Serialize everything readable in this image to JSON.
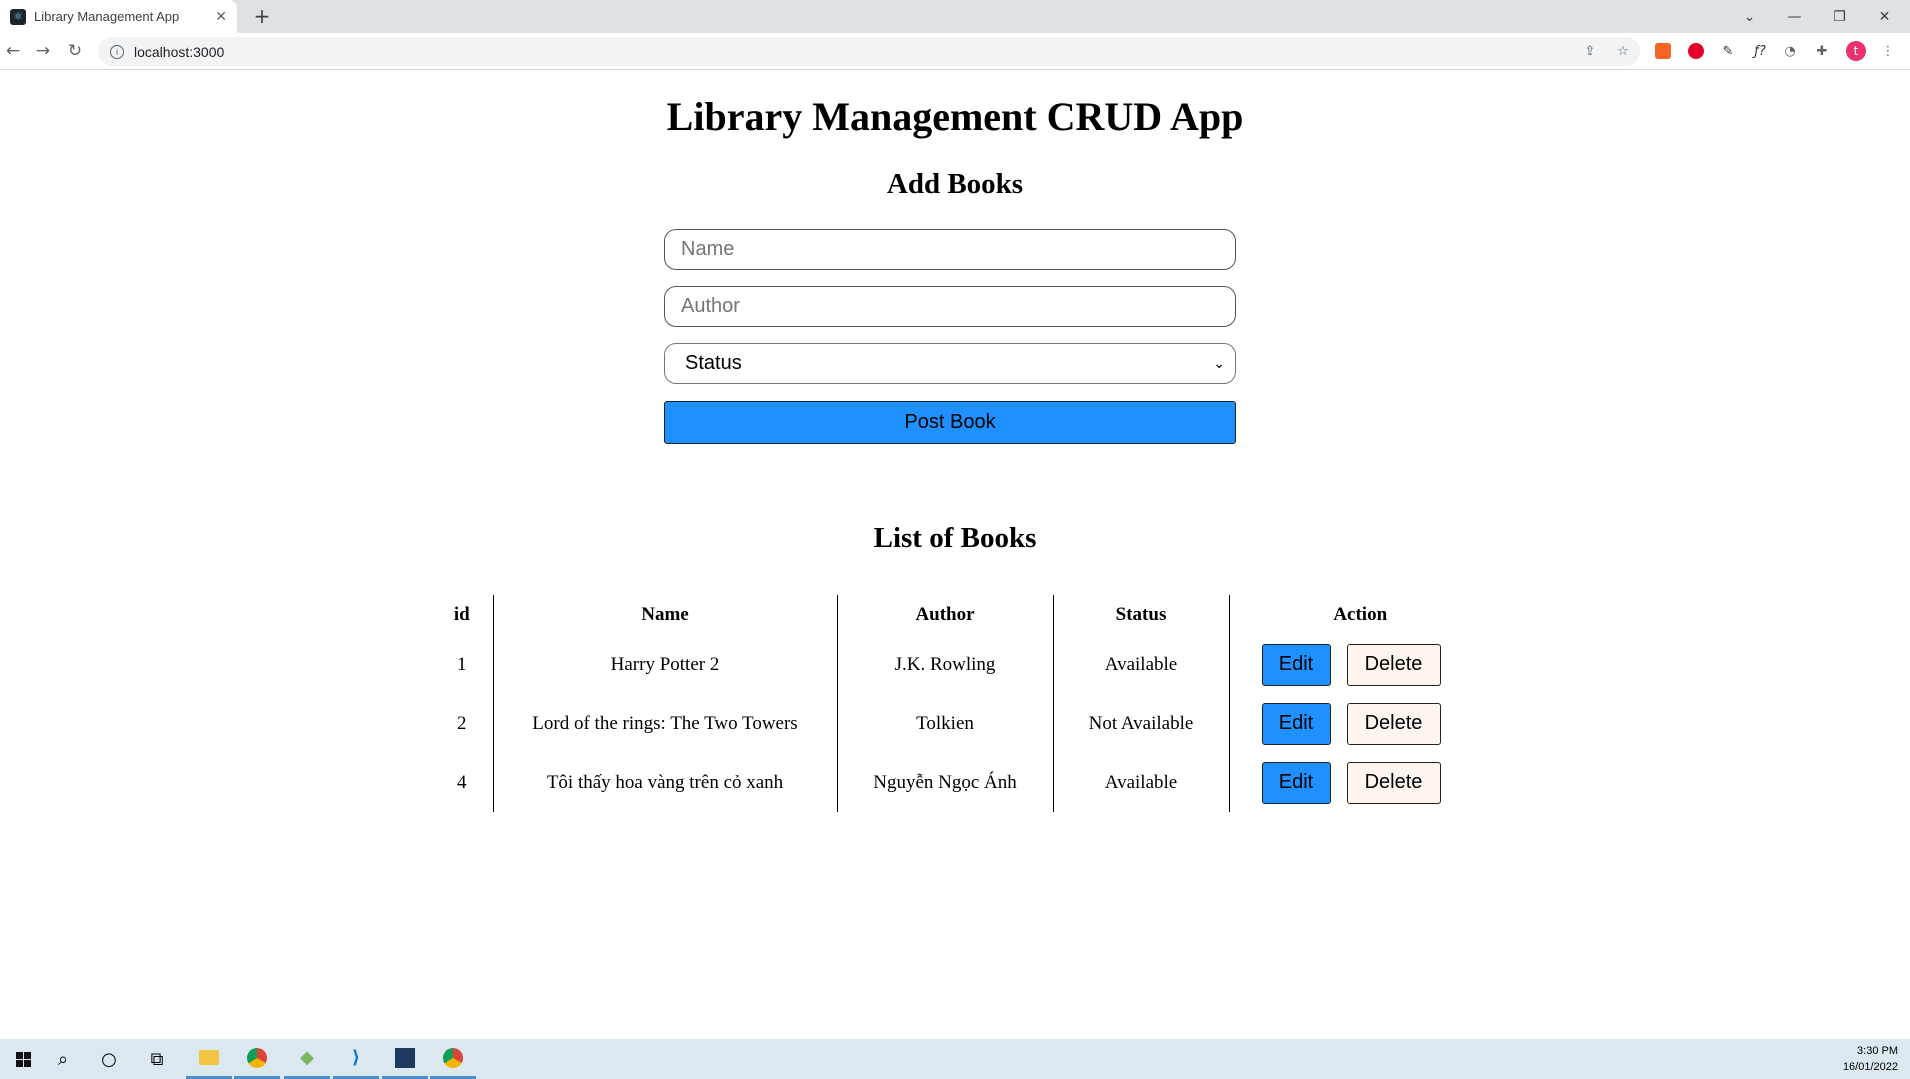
{
  "browser": {
    "tab_title": "Library Management App",
    "url": "localhost:3000",
    "profile_initial": "t"
  },
  "page": {
    "title": "Library Management CRUD App",
    "add_heading": "Add Books",
    "name_placeholder": "Name",
    "author_placeholder": "Author",
    "status_selected": "Status",
    "post_label": "Post Book",
    "list_heading": "List of Books",
    "columns": [
      "id",
      "Name",
      "Author",
      "Status",
      "Action"
    ],
    "edit_label": "Edit",
    "delete_label": "Delete",
    "rows": [
      {
        "id": "1",
        "name": "Harry Potter 2",
        "author": "J.K. Rowling",
        "status": "Available"
      },
      {
        "id": "2",
        "name": "Lord of the rings: The Two Towers",
        "author": "Tolkien",
        "status": "Not Available"
      },
      {
        "id": "4",
        "name": "Tôi thấy hoa vàng trên cỏ xanh",
        "author": "Nguyễn Ngọc Ánh",
        "status": "Available"
      }
    ]
  },
  "taskbar": {
    "time": "3:30 PM",
    "date": "16/01/2022"
  },
  "colors": {
    "accent_button": "#1e90ff",
    "delete_button": "#fdf5ee"
  }
}
